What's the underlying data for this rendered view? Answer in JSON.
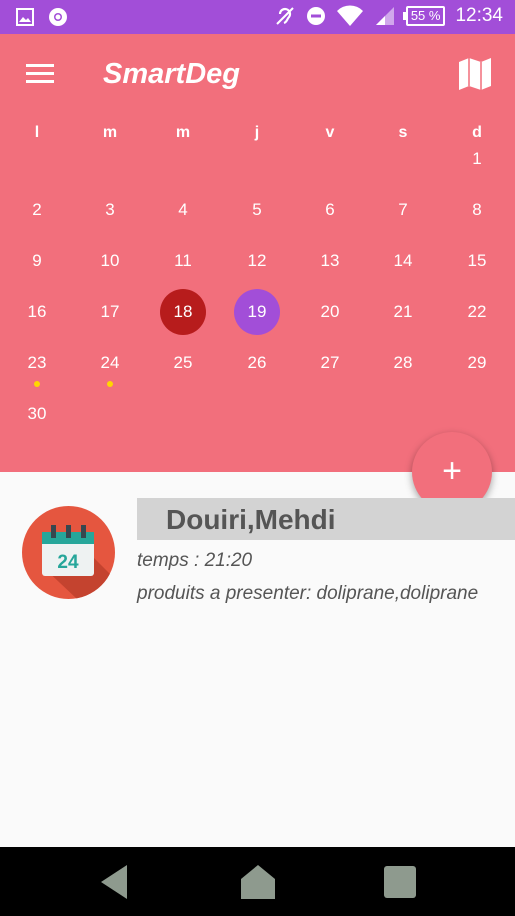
{
  "status_bar": {
    "battery": "55 %",
    "time": "12:34"
  },
  "app": {
    "title": "SmartDeg"
  },
  "calendar": {
    "weekdays": [
      "l",
      "m",
      "m",
      "j",
      "v",
      "s",
      "d"
    ],
    "weeks": [
      [
        "",
        "",
        "",
        "",
        "",
        "",
        "1"
      ],
      [
        "2",
        "3",
        "4",
        "5",
        "6",
        "7",
        "8"
      ],
      [
        "9",
        "10",
        "11",
        "12",
        "13",
        "14",
        "15"
      ],
      [
        "16",
        "17",
        "18",
        "19",
        "20",
        "21",
        "22"
      ],
      [
        "23",
        "24",
        "25",
        "26",
        "27",
        "28",
        "29"
      ],
      [
        "30",
        "",
        "",
        "",
        "",
        "",
        ""
      ]
    ],
    "selected_day": "18",
    "today_day": "19",
    "event_dot_days": [
      "23",
      "24"
    ]
  },
  "fab": {
    "label": "+"
  },
  "event": {
    "name": "Douiri,Mehdi",
    "time": "temps : 21:20",
    "products": "produits a presenter: doliprane,doliprane",
    "icon_day": "24"
  },
  "colors": {
    "status_bar": "#a24ed8",
    "header": "#f26f7c",
    "selected_day": "#b71c1c",
    "today_day": "#a24ed8",
    "event_dot": "#ffd600"
  }
}
